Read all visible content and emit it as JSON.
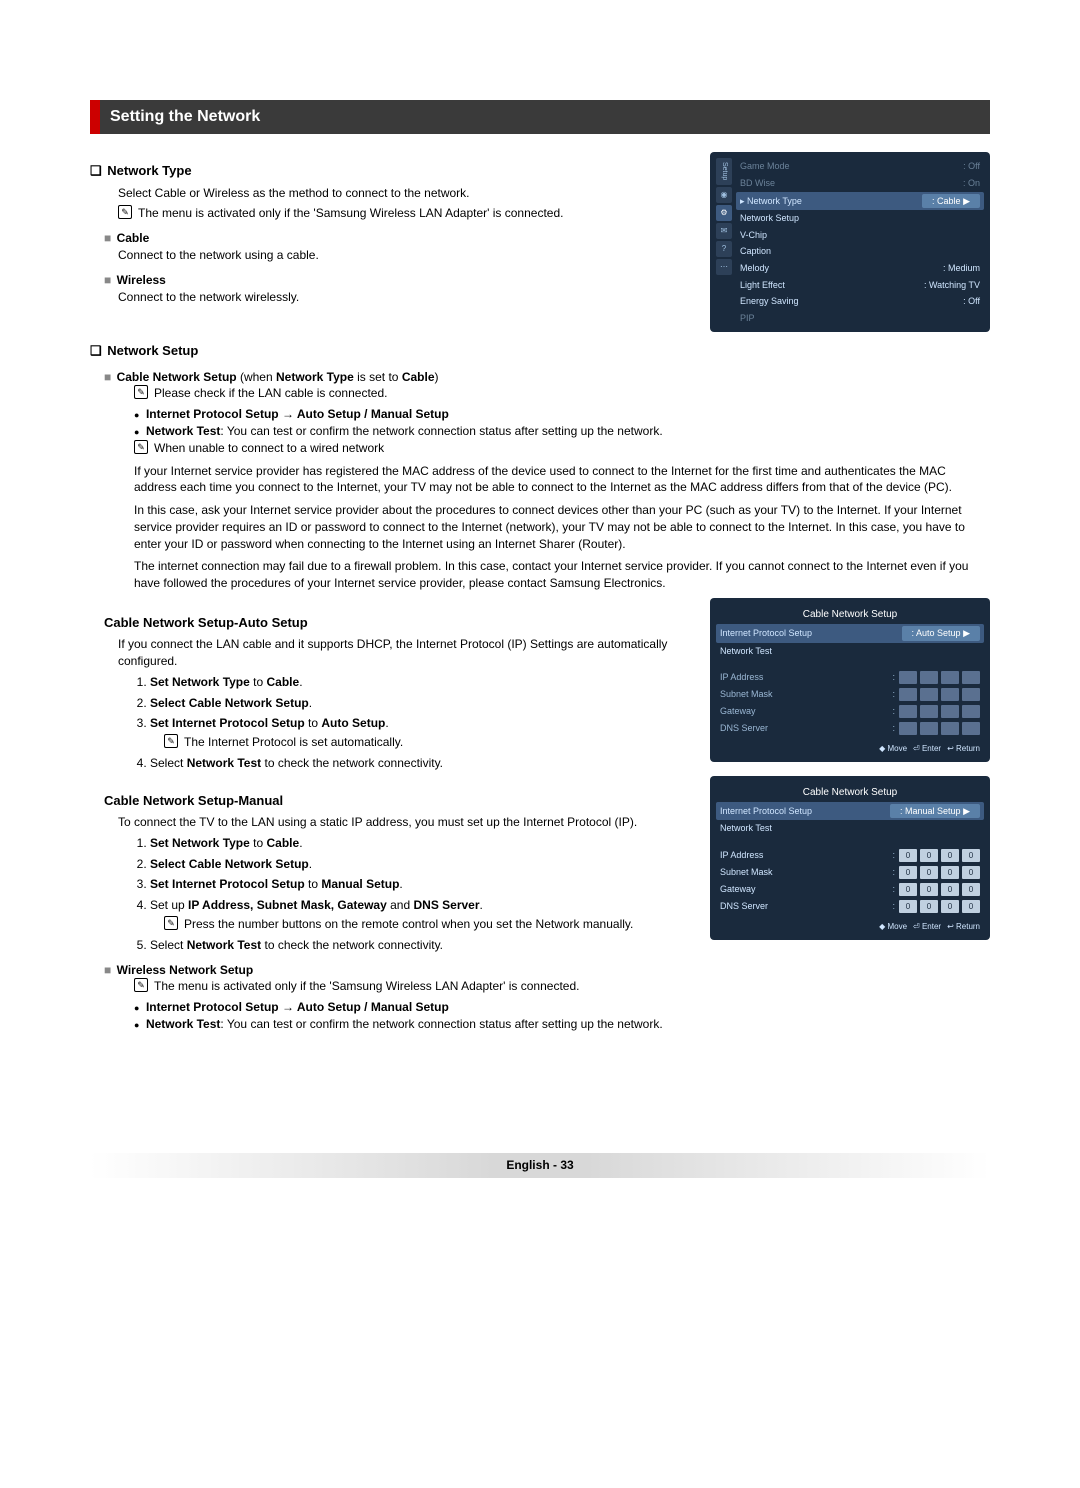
{
  "section_title": "Setting the Network",
  "network_type": {
    "heading": "Network Type",
    "intro": "Select Cable or Wireless as the method to connect to the network.",
    "note": "The menu is activated only if the 'Samsung Wireless LAN Adapter' is connected.",
    "cable": {
      "title": "Cable",
      "desc": "Connect to the network using a cable."
    },
    "wireless": {
      "title": "Wireless",
      "desc": "Connect to the network wirelessly."
    }
  },
  "network_setup": {
    "heading": "Network Setup",
    "cable_setup_prefix": "Cable Network Setup",
    "cable_setup_when": " (when ",
    "cable_setup_type": "Network Type",
    "cable_setup_is": " is set to ",
    "cable_setup_val": "Cable",
    "cable_setup_end": ")",
    "note_lan": "Please check if the LAN cable is connected.",
    "bullet_ips": "Internet Protocol Setup → Auto Setup / Manual Setup",
    "bullet_test_prefix": "Network Test",
    "bullet_test_rest": ": You can test or confirm the network connection status after setting up the network.",
    "note_unable": "When unable to connect to a wired network",
    "para1": "If your Internet service provider has registered the MAC address of the device used to connect to the Internet for the first time and authenticates the MAC address each time you connect to the Internet, your TV may not be able to connect to the Internet as the MAC address differs from that of the device (PC).",
    "para2": "In this case, ask your Internet service provider about the procedures to connect devices other than your PC (such as your TV) to the Internet. If your Internet service provider requires an ID or password to connect to the Internet (network), your TV may not be able to connect to the Internet. In this case, you have to enter your ID or password when connecting to the Internet using an Internet Sharer (Router).",
    "para3": "The internet connection may fail due to a firewall problem. In this case, contact your Internet service provider. If you cannot connect to the Internet even if you have followed the procedures of your Internet service provider, please contact Samsung Electronics."
  },
  "auto_setup": {
    "title": "Cable Network Setup-Auto Setup",
    "intro": "If you connect the LAN cable and it supports DHCP, the Internet Protocol (IP) Settings are automatically configured.",
    "s1a": "Set ",
    "s1b": "Network Type",
    "s1c": " to ",
    "s1d": "Cable",
    "s1e": ".",
    "s2a": "Select ",
    "s2b": "Cable Network Setup",
    "s2c": ".",
    "s3a": "Set ",
    "s3b": "Internet Protocol Setup",
    "s3c": " to ",
    "s3d": "Auto Setup",
    "s3e": ".",
    "s3note": "The Internet Protocol is set automatically.",
    "s4a": "Select ",
    "s4b": "Network Test",
    "s4c": " to check the network connectivity."
  },
  "manual_setup": {
    "title": "Cable Network Setup-Manual",
    "intro": "To connect the TV to the LAN using a static IP address, you must set up the Internet Protocol (IP).",
    "s1a": "Set ",
    "s1b": "Network Type",
    "s1c": " to ",
    "s1d": "Cable",
    "s1e": ".",
    "s2a": "Select ",
    "s2b": "Cable Network Setup",
    "s2c": ".",
    "s3a": "Set ",
    "s3b": "Internet Protocol Setup",
    "s3c": " to ",
    "s3d": "Manual Setup",
    "s3e": ".",
    "s4a": "Set up ",
    "s4b": "IP Address, Subnet Mask, Gateway",
    "s4c": " and ",
    "s4d": "DNS Server",
    "s4e": ".",
    "s4note": "Press the number buttons on the remote control when you set the Network manually.",
    "s5a": "Select ",
    "s5b": "Network Test",
    "s5c": " to check the network connectivity."
  },
  "wireless_setup": {
    "title": "Wireless Network Setup",
    "note": "The menu is activated only if the 'Samsung Wireless LAN Adapter' is connected.",
    "bullet_ips": "Internet Protocol Setup → Auto Setup / Manual Setup",
    "bullet_test_prefix": "Network Test",
    "bullet_test_rest": ": You can test or confirm the network connection status after setting up the network."
  },
  "osd1": {
    "setup_label": "Setup",
    "rows": [
      {
        "label": "Game Mode",
        "value": ": Off",
        "dim": true
      },
      {
        "label": "BD Wise",
        "value": ": On",
        "dim": true
      },
      {
        "label": "▸ Network Type",
        "value": ": Cable",
        "hl": true,
        "arrow": "▶"
      },
      {
        "label": "Network Setup",
        "value": ""
      },
      {
        "label": "V-Chip",
        "value": ""
      },
      {
        "label": "Caption",
        "value": ""
      },
      {
        "label": "Melody",
        "value": ": Medium"
      },
      {
        "label": "Light Effect",
        "value": ": Watching TV"
      },
      {
        "label": "Energy Saving",
        "value": ": Off"
      },
      {
        "label": "PIP",
        "value": "",
        "dim": true
      }
    ]
  },
  "osd2": {
    "title": "Cable Network Setup",
    "ips_label": "Internet Protocol Setup",
    "ips_val": ": Auto Setup",
    "test_label": "Network Test",
    "fields": [
      "IP Address",
      "Subnet Mask",
      "Gateway",
      "DNS Server"
    ],
    "footer": {
      "move": "◆ Move",
      "enter": "⏎ Enter",
      "ret": "↩ Return"
    }
  },
  "osd3": {
    "title": "Cable Network Setup",
    "ips_label": "Internet Protocol Setup",
    "ips_val": ": Manual Setup",
    "test_label": "Network Test",
    "fields": [
      {
        "label": "IP Address",
        "vals": [
          "0",
          "0",
          "0",
          "0"
        ]
      },
      {
        "label": "Subnet Mask",
        "vals": [
          "0",
          "0",
          "0",
          "0"
        ]
      },
      {
        "label": "Gateway",
        "vals": [
          "0",
          "0",
          "0",
          "0"
        ]
      },
      {
        "label": "DNS Server",
        "vals": [
          "0",
          "0",
          "0",
          "0"
        ]
      }
    ],
    "footer": {
      "move": "◆ Move",
      "enter": "⏎ Enter",
      "ret": "↩ Return"
    }
  },
  "footer": {
    "lang": "English - ",
    "page": "33"
  }
}
